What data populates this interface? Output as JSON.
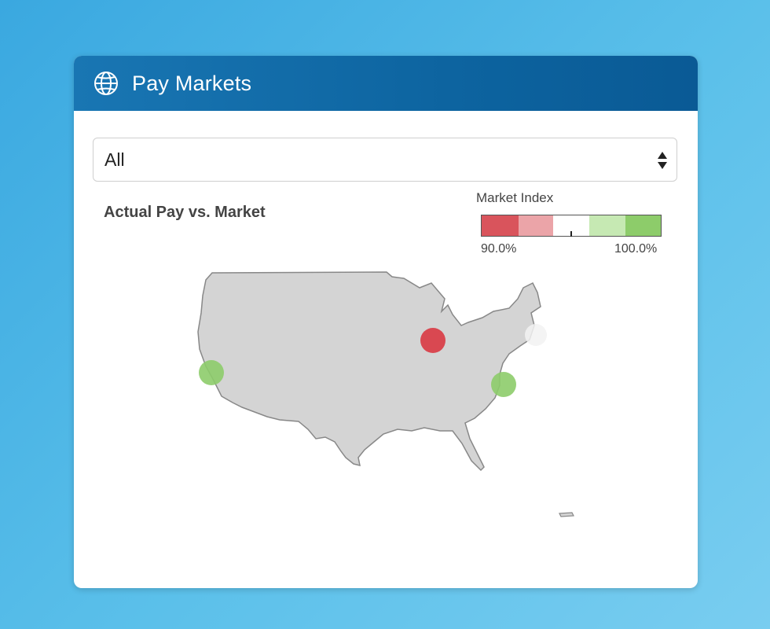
{
  "card": {
    "title": "Pay Markets",
    "icon": "globe-icon"
  },
  "filter": {
    "selected": "All"
  },
  "chart_data": {
    "type": "map",
    "title": "Actual Pay vs. Market",
    "legend": {
      "title": "Market Index",
      "min_label": "90.0%",
      "max_label": "100.0%",
      "colors": [
        "#d9545c",
        "#eba4a8",
        "#ffffff",
        "#c6e9b3",
        "#8dcc6a"
      ]
    },
    "markets": [
      {
        "name": "California",
        "status": "above",
        "color": "#8dcc6a"
      },
      {
        "name": "Chicago",
        "status": "below",
        "color": "#d9404a"
      },
      {
        "name": "Northeast",
        "status": "neutral",
        "color": "#f0f0f0"
      },
      {
        "name": "Southeast Coast",
        "status": "above",
        "color": "#8dcc6a"
      }
    ]
  }
}
